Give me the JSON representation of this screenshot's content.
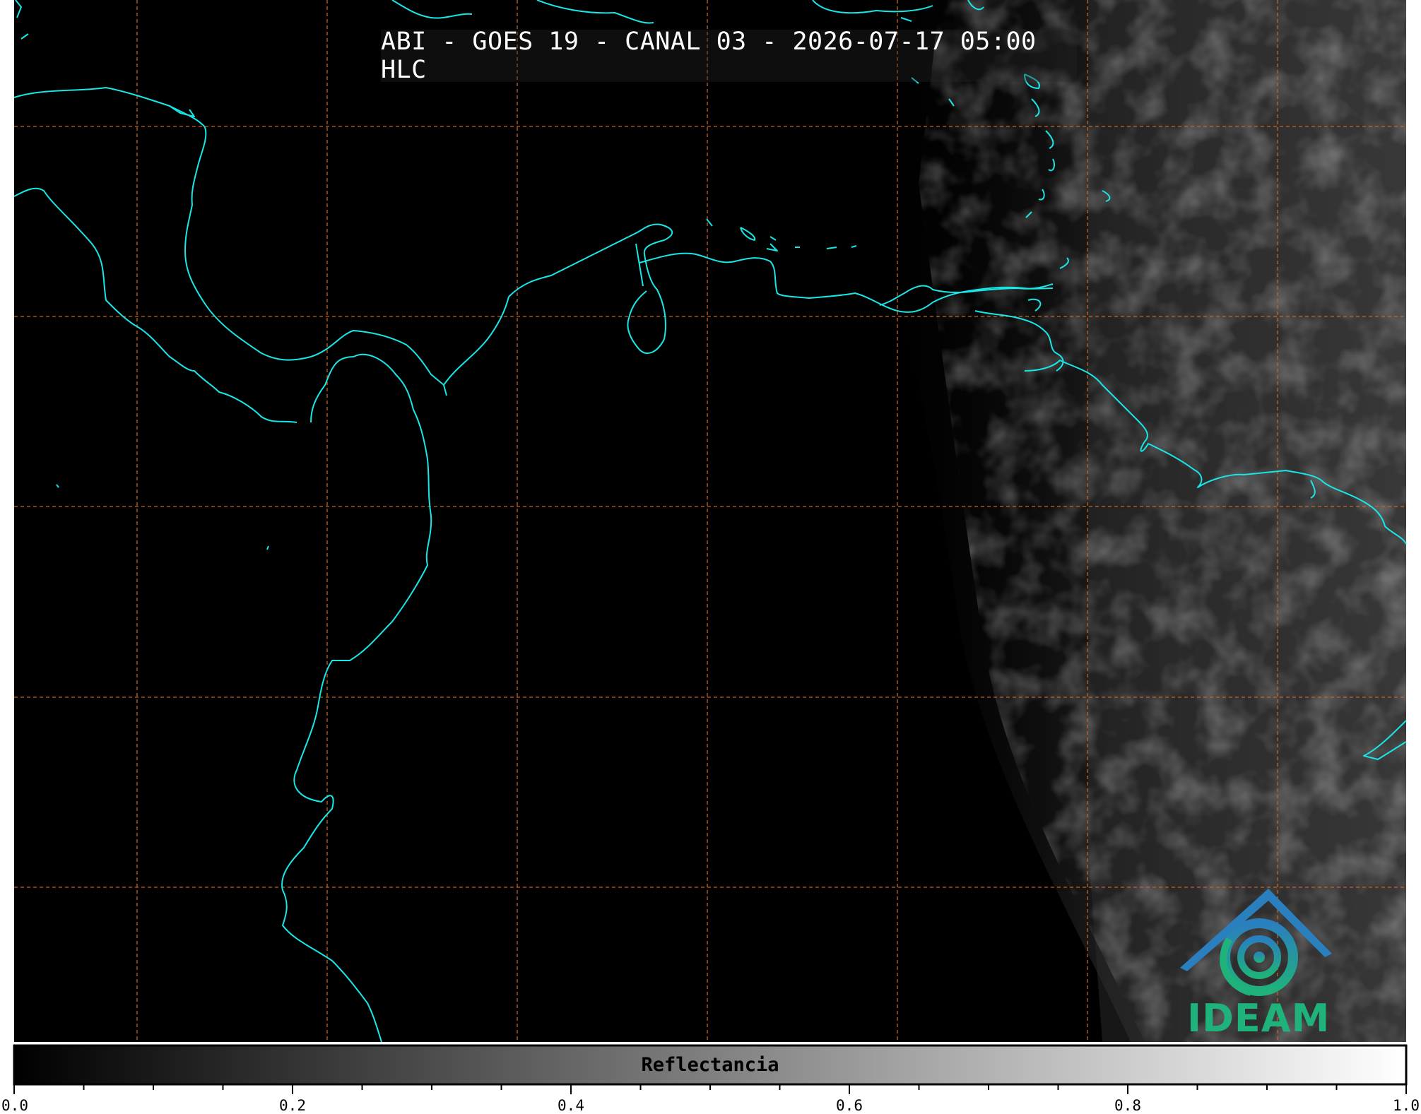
{
  "map": {
    "title": "ABI - GOES 19 - CANAL 03 - 2026-07-17 05:00 HLC",
    "coastline_color": "#19e6e6",
    "grid_color": "#c8641e",
    "background_color": "#000000"
  },
  "colorbar": {
    "label": "Reflectancia",
    "range": [
      0.0,
      1.0
    ],
    "ticks": [
      "0.0",
      "0.2",
      "0.4",
      "0.6",
      "0.8",
      "1.0"
    ],
    "colormap": "greys"
  },
  "logo": {
    "text": "IDEAM"
  }
}
